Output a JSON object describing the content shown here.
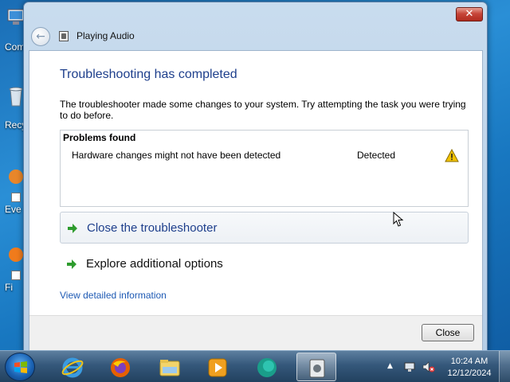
{
  "desktop": {
    "icons": [
      {
        "label": "Com",
        "icon": "computer-icon"
      },
      {
        "label": "Recy",
        "icon": "recycle-bin-icon"
      },
      {
        "label": "Eve",
        "icon": "shortcut-icon"
      },
      {
        "label": "Fi",
        "icon": "firefox-shortcut-icon"
      }
    ]
  },
  "window": {
    "title": "Playing Audio",
    "close_glyph": "✕",
    "heading": "Troubleshooting has completed",
    "description": "The troubleshooter made some changes to your system. Try attempting the task you were trying to do before.",
    "problems": {
      "header": "Problems found",
      "rows": [
        {
          "description": "Hardware changes might not have been detected",
          "status": "Detected",
          "icon": "warning-icon"
        }
      ]
    },
    "actions": [
      {
        "label": "Close the troubleshooter",
        "icon": "green-arrow-icon"
      },
      {
        "label": "Explore additional options",
        "icon": "green-arrow-icon"
      }
    ],
    "detail_link": "View detailed information",
    "close_button": "Close"
  },
  "taskbar": {
    "pinned": [
      "internet-explorer-icon",
      "firefox-icon",
      "file-explorer-icon",
      "media-player-icon",
      "app-icon",
      "troubleshooter-icon"
    ],
    "tray_arrow": "▲",
    "clock": {
      "time": "10:24 AM",
      "date": "12/12/2024"
    }
  },
  "colors": {
    "heading": "#1e3f8c",
    "link": "#1e5ab4",
    "action_arrow": "#2e9c2e",
    "warning": "#f2c200"
  }
}
